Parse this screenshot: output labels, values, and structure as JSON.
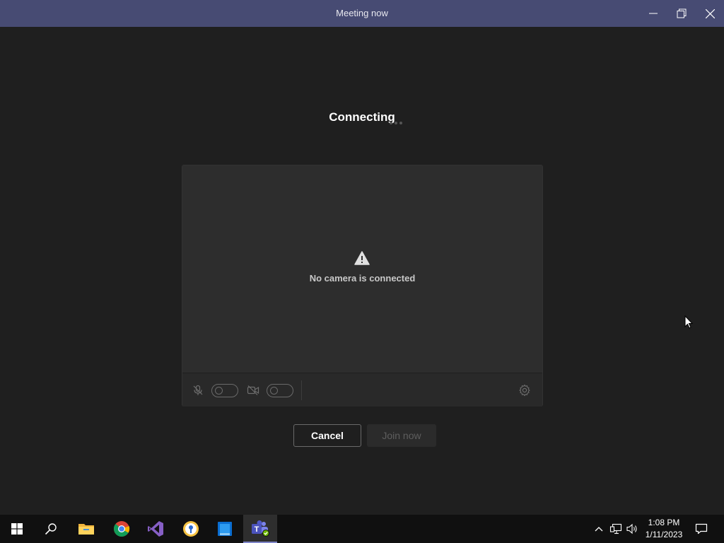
{
  "window": {
    "title": "Meeting now"
  },
  "status": {
    "connecting": "Connecting"
  },
  "preview": {
    "no_camera": "No camera is connected"
  },
  "buttons": {
    "cancel": "Cancel",
    "join": "Join now"
  },
  "clock": {
    "time": "1:08 PM",
    "date": "1/11/2023"
  },
  "taskbar": {
    "items": [
      "windows-start-icon",
      "search-icon",
      "file-explorer-icon",
      "chrome-icon",
      "visual-studio-icon",
      "keepassxc-icon",
      "app-icon",
      "teams-icon"
    ],
    "tray": [
      "show-hidden-icons-chevron-icon",
      "network-icon",
      "volume-icon",
      "notifications-icon"
    ]
  },
  "colors": {
    "titlebar": "#474b73",
    "background": "#1f1f1f",
    "taskbar": "#101010",
    "accent": "#7f85c9"
  }
}
